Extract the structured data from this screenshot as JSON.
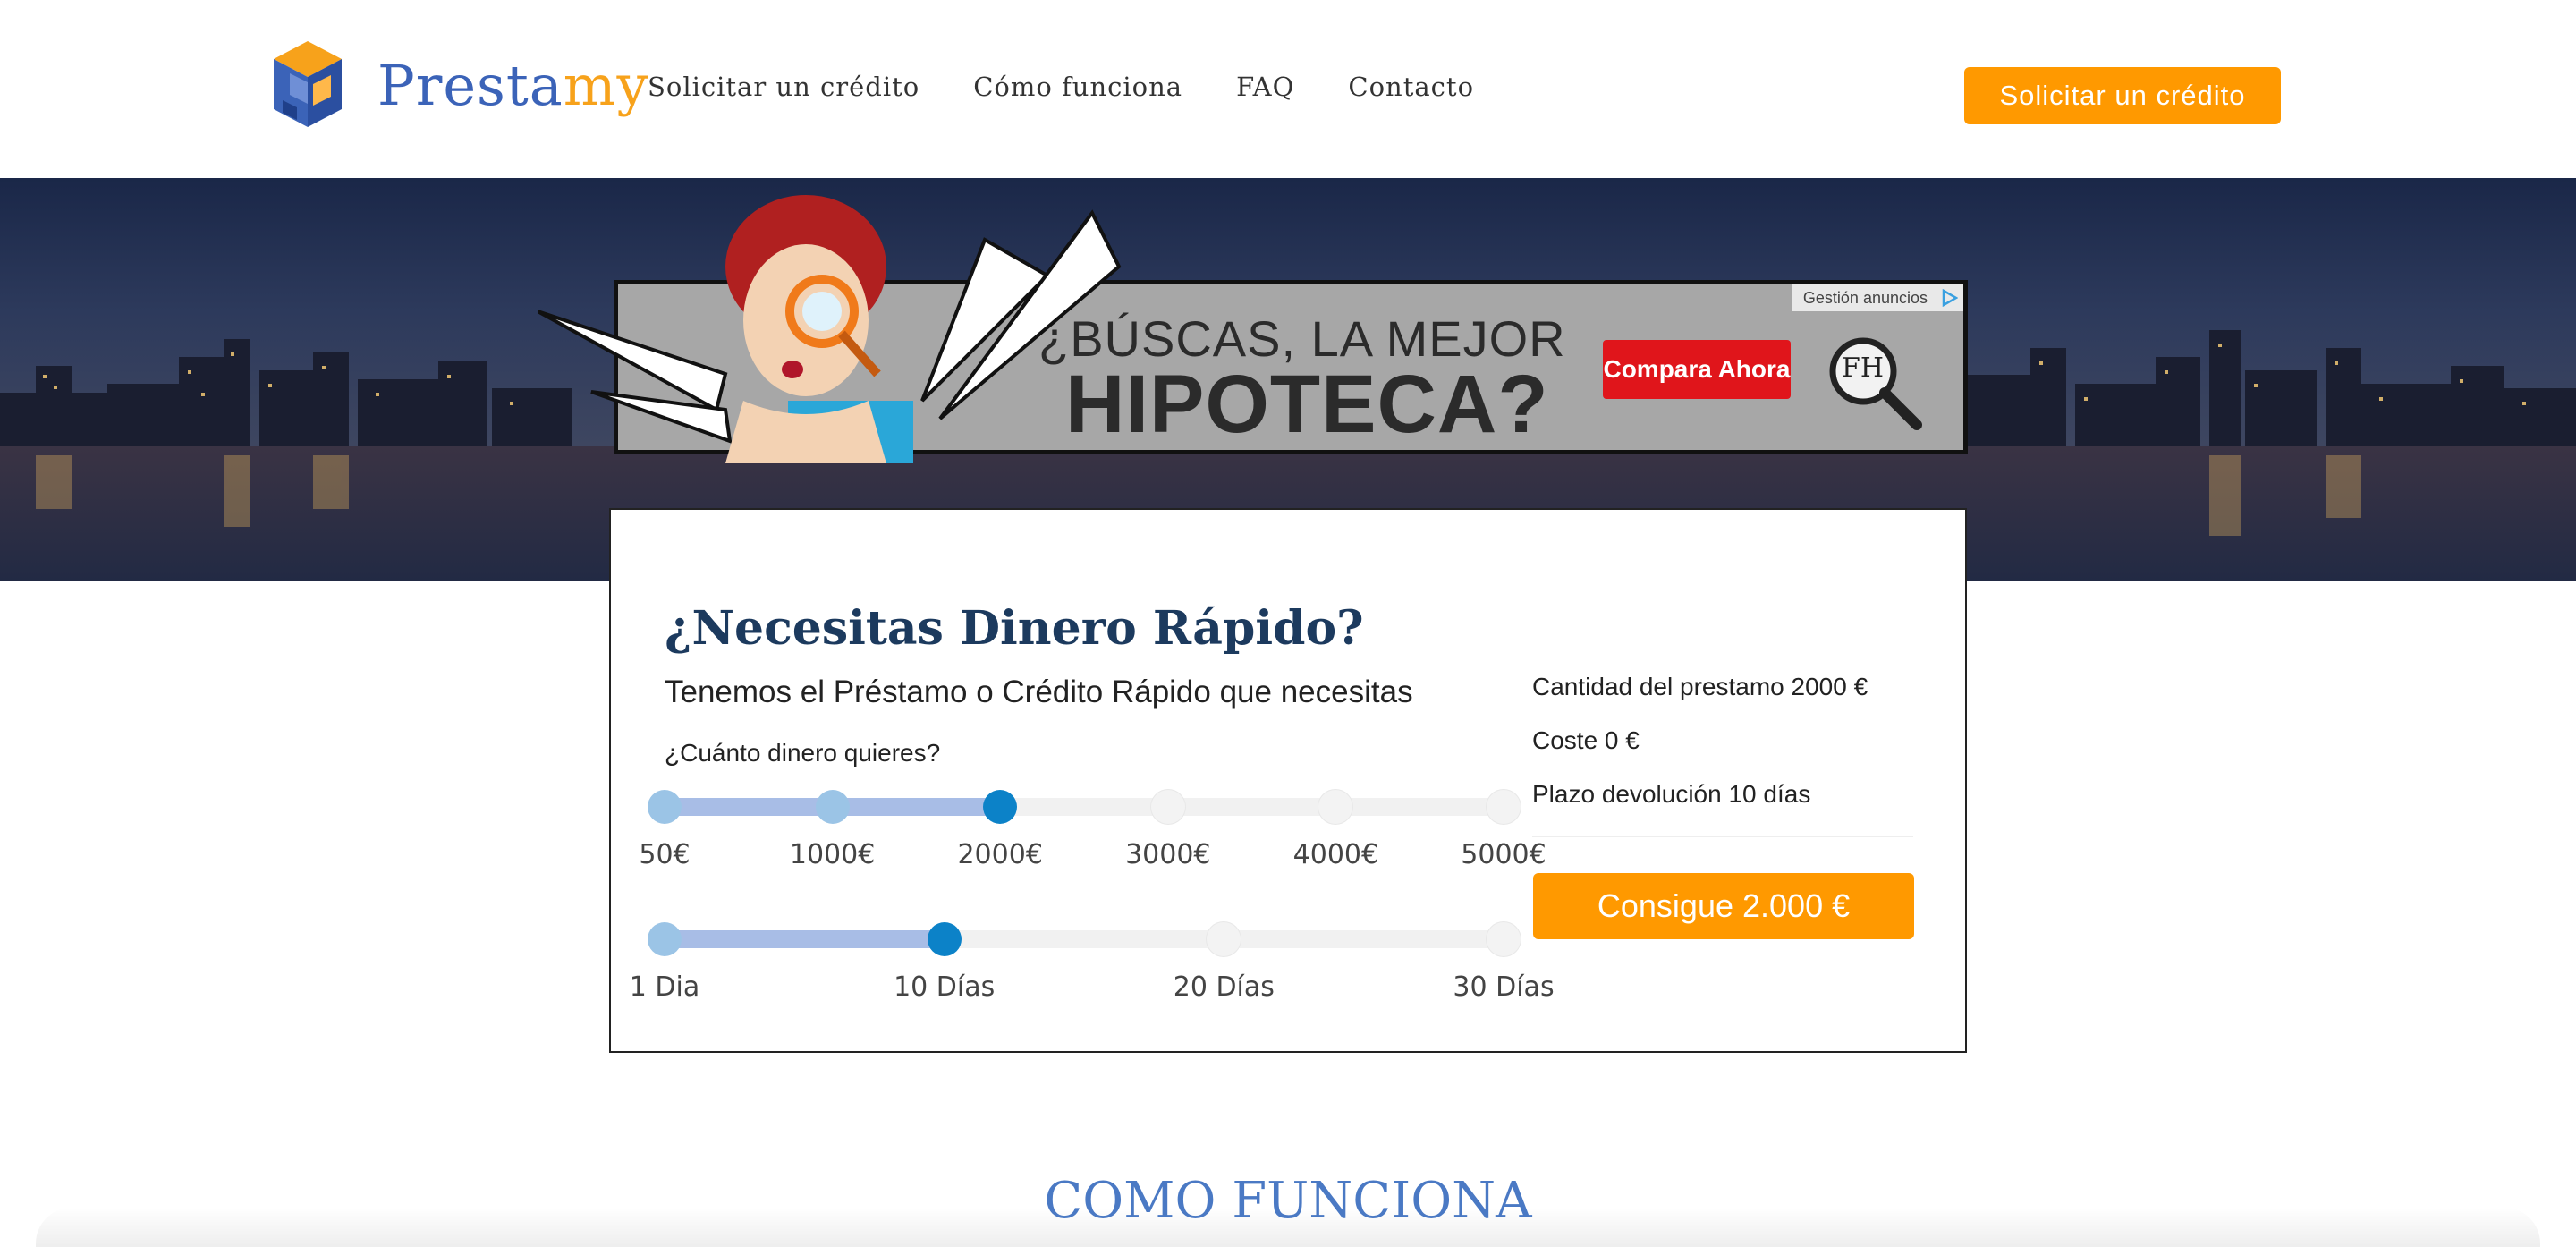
{
  "header": {
    "logo_text_main": "Presta",
    "logo_text_accent": "my",
    "nav": [
      {
        "label": "Solicitar un crédito"
      },
      {
        "label": "Cómo funciona"
      },
      {
        "label": "FAQ"
      },
      {
        "label": "Contacto"
      }
    ],
    "cta_label": "Solicitar un crédito"
  },
  "ad": {
    "line1": "¿BÚSCAS, LA MEJOR",
    "line2": "HIPOTECA?",
    "button": "Compara Ahora",
    "gestion": "Gestión anuncios",
    "logo_text": "FH"
  },
  "calculator": {
    "title": "¿Necesitas Dinero Rápido?",
    "subtitle": "Tenemos el Préstamo o Crédito Rápido que necesitas",
    "question": "¿Cuánto dinero quieres?",
    "amount_ticks": [
      "50€",
      "1000€",
      "2000€",
      "3000€",
      "4000€",
      "5000€"
    ],
    "amount_selected_index": 2,
    "days_ticks": [
      "1 Dia",
      "10 Días",
      "20 Días",
      "30 Días"
    ],
    "days_selected_index": 1,
    "summary": {
      "amount": "Cantidad del prestamo 2000 €",
      "cost": "Coste 0 €",
      "term": "Plazo devolución 10 días"
    },
    "cta": "Consigue 2.000 €"
  },
  "section": {
    "title": "COMO FUNCIONA"
  },
  "colors": {
    "accent": "#ff9900",
    "brand_blue": "#3b63b8",
    "title_navy": "#1c3a5e",
    "slider_active": "#0c82c8"
  }
}
